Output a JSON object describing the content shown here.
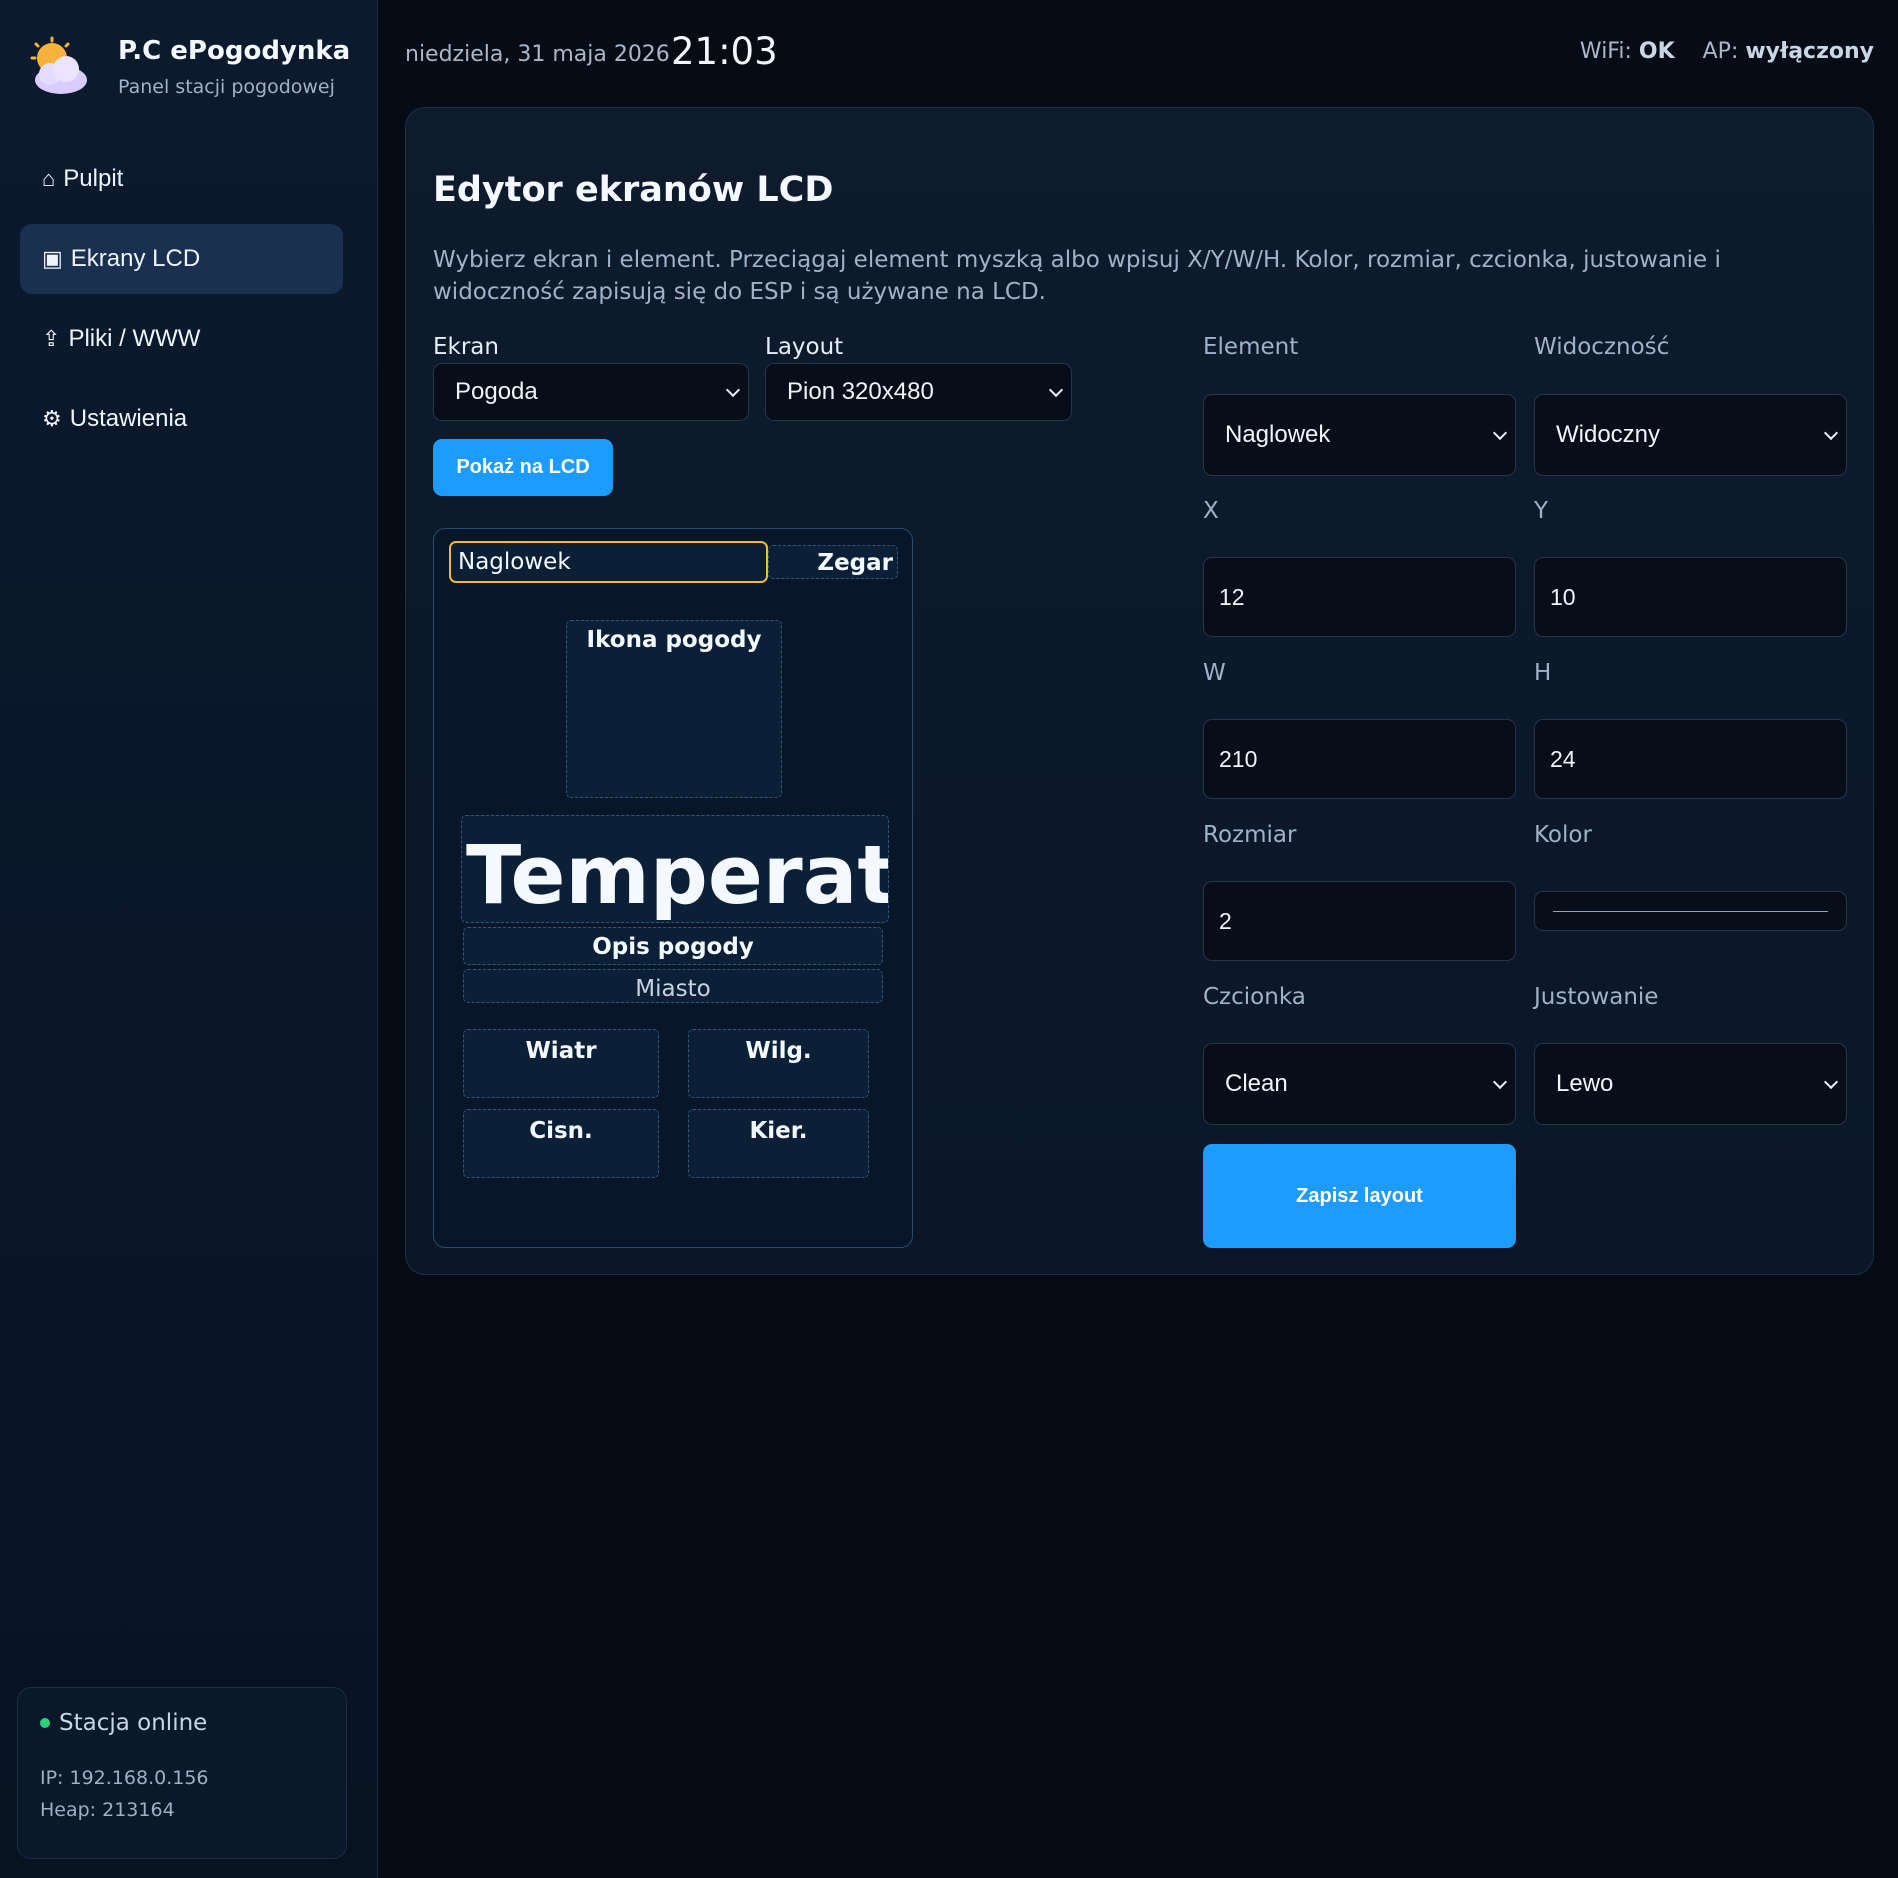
{
  "brand": {
    "title": "P.C ePogodynka",
    "subtitle": "Panel stacji pogodowej"
  },
  "nav": [
    {
      "icon": "⌂",
      "icon_name": "home-icon",
      "label": "Pulpit"
    },
    {
      "icon": "▣",
      "icon_name": "screen-icon",
      "label": "Ekrany LCD",
      "active": true
    },
    {
      "icon": "⇪",
      "icon_name": "upload-icon",
      "label": "Pliki / WWW"
    },
    {
      "icon": "⚙",
      "icon_name": "gear-icon",
      "label": "Ustawienia"
    }
  ],
  "status": {
    "text": "Stacja online",
    "ip": "IP: 192.168.0.156",
    "heap": "Heap: 213164",
    "dot_color": "#2ad27a"
  },
  "topbar": {
    "date": "niedziela, 31 maja 2026",
    "time": "21:03",
    "wifi_label": "WiFi:",
    "wifi_value": "OK",
    "ap_label": "AP:",
    "ap_value": "wyłączony"
  },
  "editor": {
    "title": "Edytor ekranów LCD",
    "description": "Wybierz ekran i element. Przeciągaj element myszką albo wpisuj X/Y/W/H. Kolor, rozmiar, czcionka, justowanie i widoczność zapisują się do ESP i są używane na LCD.",
    "screen_label": "Ekran",
    "screen_value": "Pogoda",
    "layout_label": "Layout",
    "layout_value": "Pion 320x480",
    "show_button": "Pokaż na LCD",
    "element_label": "Element",
    "element_value": "Naglowek",
    "visibility_label": "Widoczność",
    "visibility_value": "Widoczny",
    "x_label": "X",
    "x_value": "12",
    "y_label": "Y",
    "y_value": "10",
    "w_label": "W",
    "w_value": "210",
    "h_label": "H",
    "h_value": "24",
    "size_label": "Rozmiar",
    "size_value": "2",
    "color_label": "Kolor",
    "font_label": "Czcionka",
    "font_value": "Clean",
    "align_label": "Justowanie",
    "align_value": "Lewo",
    "save_button": "Zapisz layout",
    "accent_color": "#1e9bff",
    "selected_color": "#f2b840"
  },
  "lcd_preview": {
    "header": "Naglowek",
    "clock": "Zegar",
    "weather_icon": "Ikona pogody",
    "temperature": "Temperatura",
    "description": "Opis pogody",
    "city": "Miasto",
    "wind": "Wiatr",
    "humidity": "Wilg.",
    "pressure": "Cisn.",
    "direction": "Kier."
  }
}
